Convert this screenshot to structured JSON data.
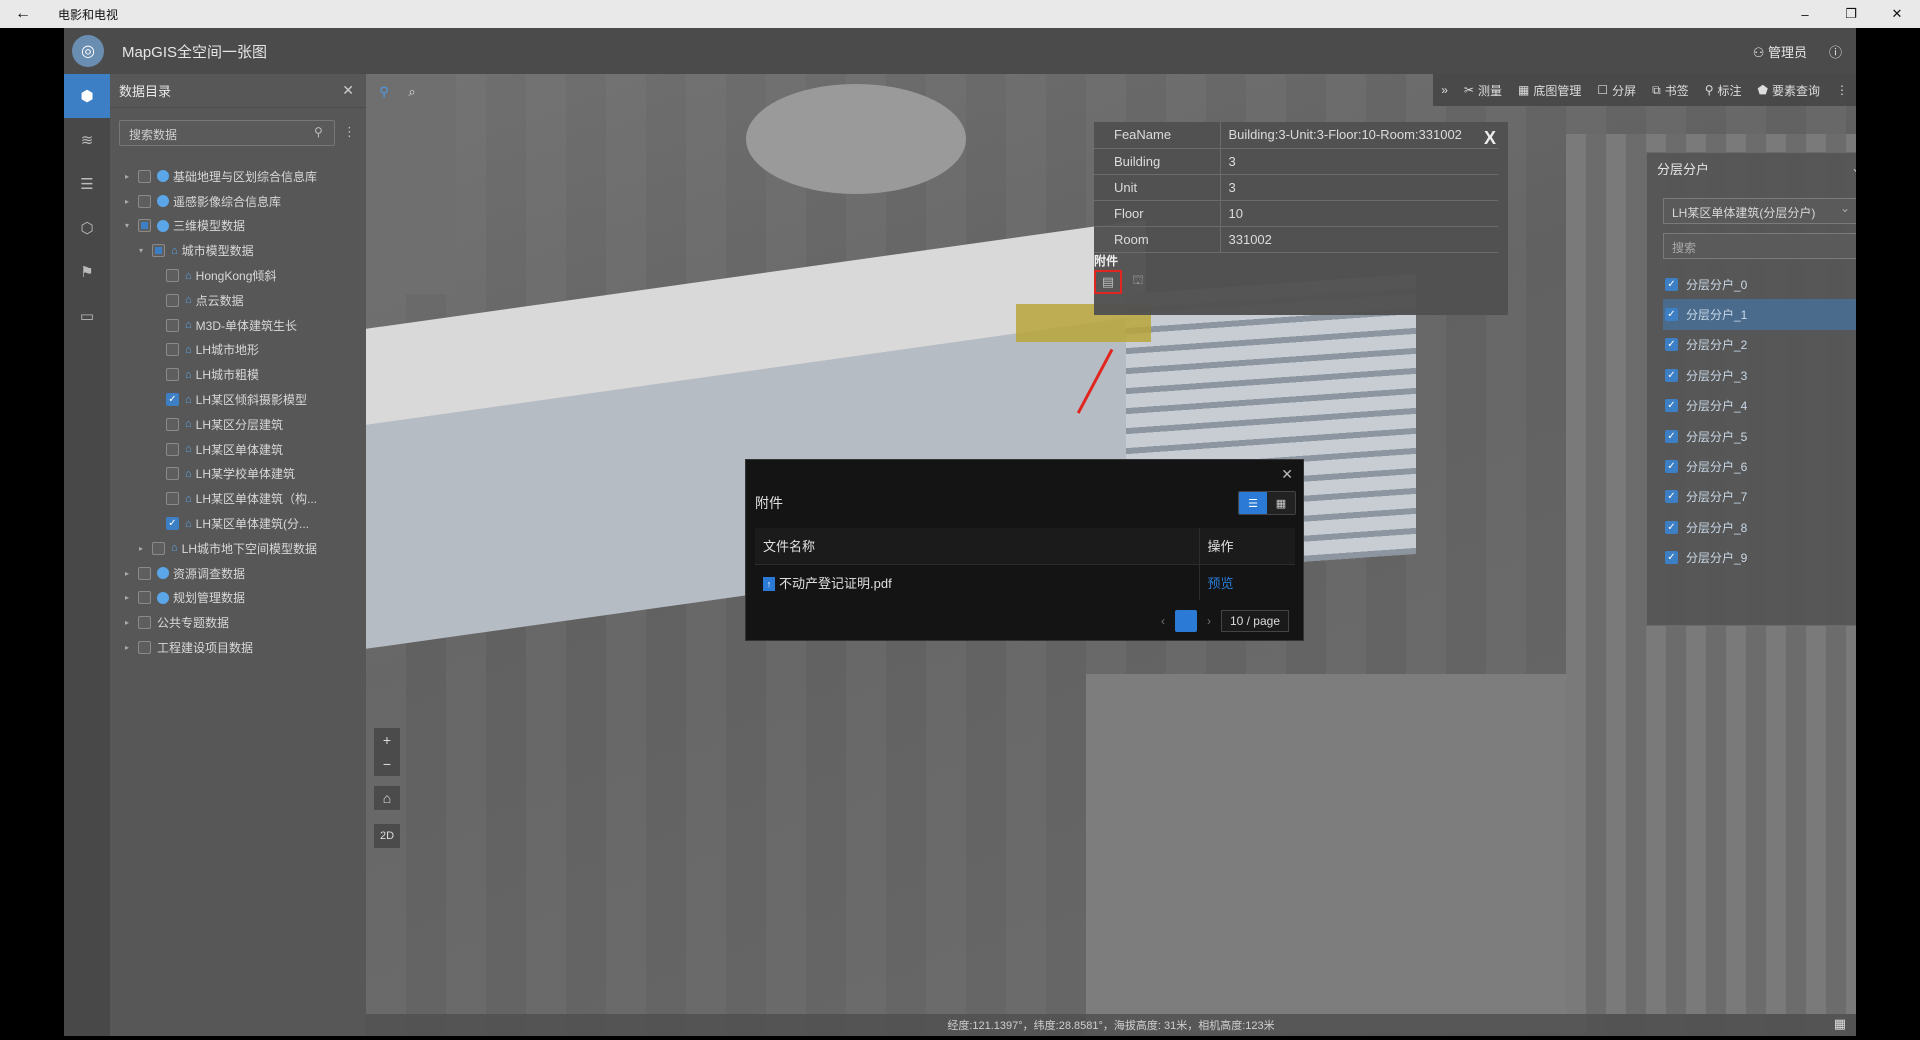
{
  "window": {
    "title": "电影和电视",
    "back": "←",
    "minimize": "–",
    "restore": "❐",
    "close": "✕"
  },
  "app": {
    "title": "MapGIS全空间一张图",
    "user": "管理员"
  },
  "catalog": {
    "title": "数据目录",
    "search_placeholder": "搜索数据",
    "tree": [
      {
        "label": "基础地理与区划综合信息库",
        "level": 0,
        "caret": "▸",
        "icon": "globe",
        "checked": "none"
      },
      {
        "label": "遥感影像综合信息库",
        "level": 0,
        "caret": "▸",
        "icon": "globe",
        "checked": "none"
      },
      {
        "label": "三维模型数据",
        "level": 0,
        "caret": "▾",
        "icon": "globe",
        "checked": "partial"
      },
      {
        "label": "城市模型数据",
        "level": 1,
        "caret": "▾",
        "icon": "bldg",
        "checked": "partial"
      },
      {
        "label": "HongKong倾斜",
        "level": 2,
        "caret": "",
        "icon": "bldg",
        "checked": "none"
      },
      {
        "label": "点云数据",
        "level": 2,
        "caret": "",
        "icon": "bldg",
        "checked": "none"
      },
      {
        "label": "M3D-单体建筑生长",
        "level": 2,
        "caret": "",
        "icon": "bldg",
        "checked": "none"
      },
      {
        "label": "LH城市地形",
        "level": 2,
        "caret": "",
        "icon": "bldg",
        "checked": "none"
      },
      {
        "label": "LH城市粗模",
        "level": 2,
        "caret": "",
        "icon": "bldg",
        "checked": "none"
      },
      {
        "label": "LH某区倾斜摄影模型",
        "level": 2,
        "caret": "",
        "icon": "bldg",
        "checked": "checked"
      },
      {
        "label": "LH某区分层建筑",
        "level": 2,
        "caret": "",
        "icon": "bldg",
        "checked": "none"
      },
      {
        "label": "LH某区单体建筑",
        "level": 2,
        "caret": "",
        "icon": "bldg",
        "checked": "none"
      },
      {
        "label": "LH某学校单体建筑",
        "level": 2,
        "caret": "",
        "icon": "bldg",
        "checked": "none"
      },
      {
        "label": "LH某区单体建筑（构...",
        "level": 2,
        "caret": "",
        "icon": "bldg",
        "checked": "none"
      },
      {
        "label": "LH某区单体建筑(分...",
        "level": 2,
        "caret": "",
        "icon": "bldg",
        "checked": "checked"
      },
      {
        "label": "LH城市地下空间模型数据",
        "level": 1,
        "caret": "▸",
        "icon": "bldg",
        "checked": "none"
      },
      {
        "label": "资源调查数据",
        "level": 0,
        "caret": "▸",
        "icon": "globe",
        "checked": "none"
      },
      {
        "label": "规划管理数据",
        "level": 0,
        "caret": "▸",
        "icon": "globe",
        "checked": "none"
      },
      {
        "label": "公共专题数据",
        "level": 0,
        "caret": "▸",
        "icon": "none",
        "checked": "none"
      },
      {
        "label": "工程建设项目数据",
        "level": 0,
        "caret": "▸",
        "icon": "none",
        "checked": "none"
      }
    ]
  },
  "toolbar": {
    "collapse": "»",
    "items": [
      {
        "icon": "measure-icon",
        "glyph": "✂",
        "label": "测量"
      },
      {
        "icon": "basemap-icon",
        "glyph": "▦",
        "label": "底图管理"
      },
      {
        "icon": "split-icon",
        "glyph": "☐",
        "label": "分屏"
      },
      {
        "icon": "bookmark-icon",
        "glyph": "⧉",
        "label": "书签"
      },
      {
        "icon": "marker-icon",
        "glyph": "⚲",
        "label": "标注"
      },
      {
        "icon": "query-icon",
        "glyph": "⬟",
        "label": "要素查询"
      }
    ],
    "more": "⋮"
  },
  "attribute_popup": {
    "rows": [
      {
        "key": "FeaName",
        "value": "Building:3-Unit:3-Floor:10-Room:331002"
      },
      {
        "key": "Building",
        "value": "3"
      },
      {
        "key": "Unit",
        "value": "3"
      },
      {
        "key": "Floor",
        "value": "10"
      },
      {
        "key": "Room",
        "value": "331002"
      }
    ],
    "close": "X",
    "attachment_label": "附件"
  },
  "layer_panel": {
    "title": "分层分户",
    "select_value": "LH某区单体建筑(分层分户)",
    "search_placeholder": "搜索",
    "items": [
      "分层分户_0",
      "分层分户_1",
      "分层分户_2",
      "分层分户_3",
      "分层分户_4",
      "分层分户_5",
      "分层分户_6",
      "分层分户_7",
      "分层分户_8",
      "分层分户_9"
    ],
    "selected_index": 1
  },
  "dialog": {
    "title": "附件",
    "col_filename": "文件名称",
    "col_action": "操作",
    "file_name": "不动产登记证明.pdf",
    "action": "预览",
    "page_size": "10 / page",
    "current_page": "1"
  },
  "status_bar": {
    "text": "经度:121.1397°，纬度:28.8581°，海拔高度: 31米，相机高度:123米"
  },
  "map_controls": {
    "zoom_in": "+",
    "zoom_out": "−",
    "home": "⌂",
    "mode": "2D"
  },
  "colors": {
    "accent": "#2b7bd6",
    "highlight": "#e0261f"
  }
}
